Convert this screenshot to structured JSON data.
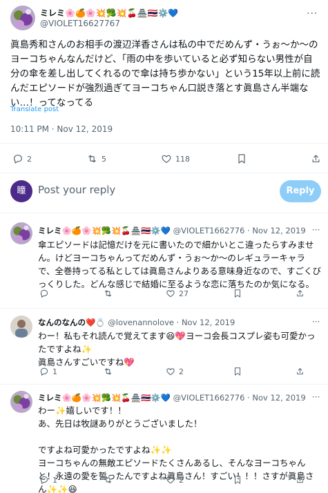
{
  "main_post": {
    "name": "ミレミ🌸🍊🌸💥🥦💥🍒🏯🇹🇭⚙️💙",
    "handle": "@VIOLET16627767",
    "text": "眞島秀和さんのお相手の渡辺洋香さんは私の中でだめんず・うぉ〜か〜のヨーコちゃんなんだけど、「雨の中を歩いていると必ず知らない男性が自分の傘を差し出してくれるので傘は持ち歩かない」という15年以上前に読んだエピソードが強烈過ぎてヨーコちゃん口説き落とす眞島さん半端ない…！ってなってる",
    "translate": "Translate post",
    "timestamp": "10:11 PM · Nov 12, 2019",
    "replies": "2",
    "reposts": "5",
    "likes": "118"
  },
  "composer": {
    "avatar_letter": "瞳",
    "placeholder": "Post your reply",
    "button": "Reply"
  },
  "replies": [
    {
      "name": "ミレミ🌸🍊🌸💥🥦💥🍒🏯🇹🇭⚙️💙",
      "handle": "@VIOLET1662776",
      "date": "· Nov 12, 2019",
      "text": "傘エピソードは記憶だけを元に書いたので細かいとこ違ったらすみません。けどヨーコちゃんってだめんず・うぉ〜か〜のレギュラーキャラで、全巻持ってる私としては眞島さんよりある意味身近なので、すごくびっくりした。どんな感じで結婚に至るような恋に落ちたのか気になる。",
      "replies": "",
      "reposts": "",
      "likes": "27"
    },
    {
      "name": "なんのなんの❤️💍",
      "handle": "@lovenannolove",
      "date": "· Nov 12, 2019",
      "text": "わー！私もそれ読んで覚えてます😆💖ヨーコ会長コスプレ姿も可愛かったですよね✨\n眞島さんすごいですね💖",
      "replies": "1",
      "reposts": "",
      "likes": "2"
    },
    {
      "name": "ミレミ🌸🍊🌸💥🥦💥🍒🏯🇹🇭⚙️💙",
      "handle": "@VIOLET1662776",
      "date": "· Nov 12, 2019",
      "text": "わー✨嬉しいです！！\nあ、先日は牧謎ありがとうございました！\n\nですよね可愛かったですよね✨✨\nヨーコちゃんの無敵エピソードたくさんあるし、そんなヨーコちゃんと！永遠の愛を誓ったんですよね眞島さん！すごい！！！さすが眞島さん✨✨😆",
      "replies": "1",
      "reposts": "",
      "likes": "2"
    }
  ],
  "colors": {
    "link": "#1d9bf0",
    "muted": "#536471",
    "reply_button": "#8ecdf8",
    "composer_avatar": "#4b2a8a",
    "divider": "#eff3f4"
  }
}
